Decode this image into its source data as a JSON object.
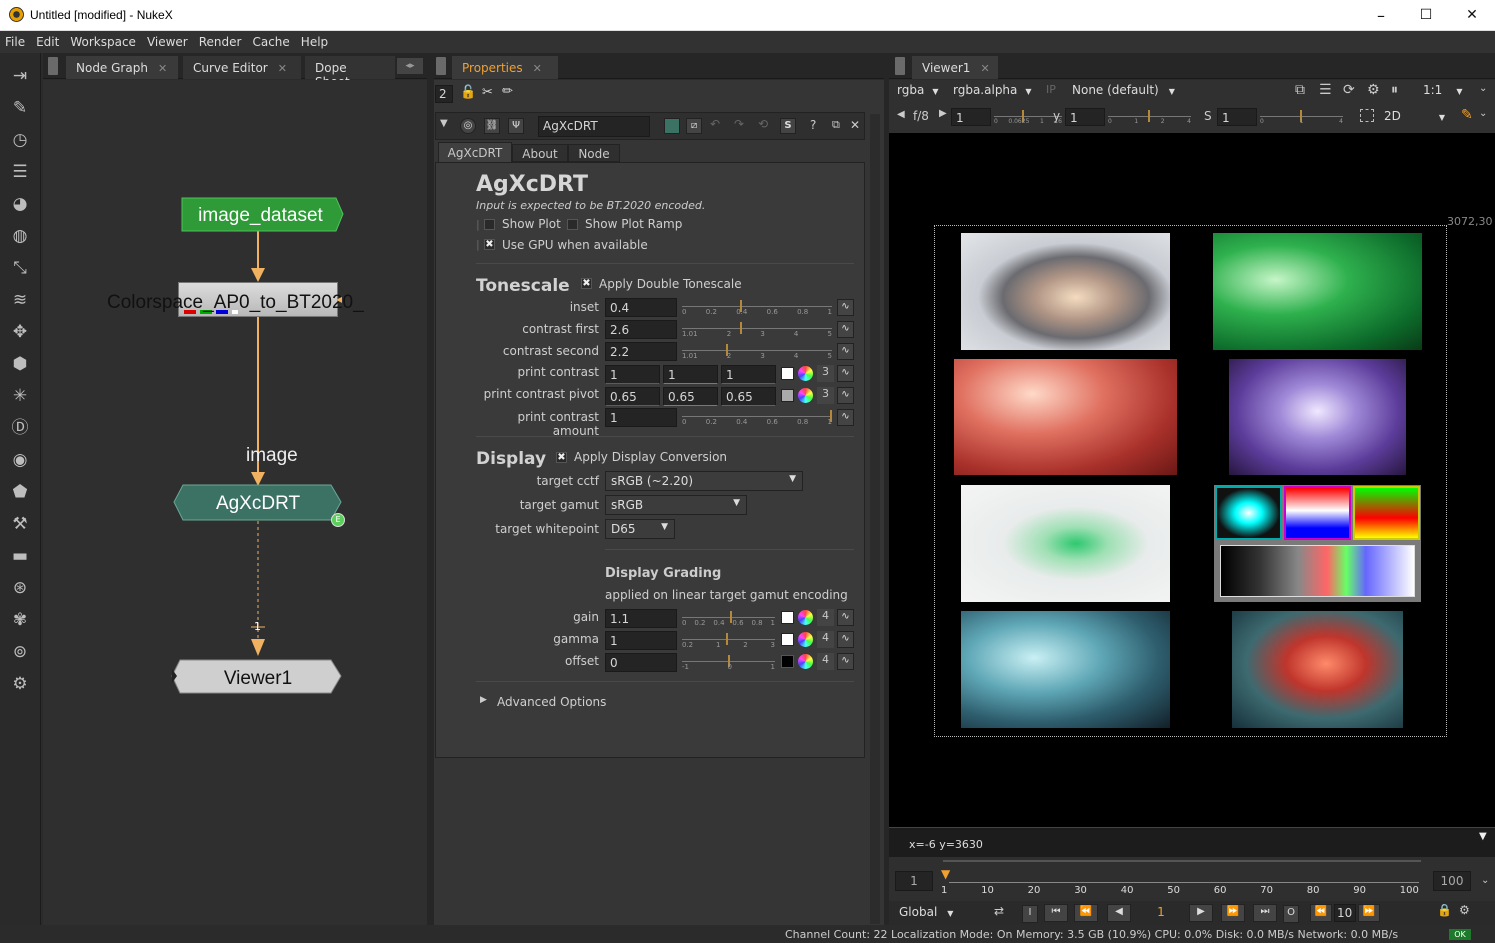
{
  "window": {
    "title": "Untitled [modified] - NukeX",
    "minimize": "–",
    "maximize": "☐",
    "close": "✕"
  },
  "menu": [
    "File",
    "Edit",
    "Workspace",
    "Viewer",
    "Render",
    "Cache",
    "Help"
  ],
  "left_tabs": {
    "node_graph": "Node Graph",
    "curve_editor": "Curve Editor",
    "dope_sheet": "Dope Sheet"
  },
  "nodes": {
    "read": "image_dataset",
    "colorspace": "Colorspace_AP0_to_BT2020_",
    "input_label": "image",
    "agx": "AgXcDRT",
    "viewer": "Viewer1",
    "viewer_pipe": "1"
  },
  "properties": {
    "tab": "Properties",
    "max_panels": "2",
    "node_name": "AgXcDRT",
    "subtabs": [
      "AgXcDRT",
      "About",
      "Node"
    ],
    "title": "AgXcDRT",
    "subtitle": "Input is expected to be BT.2020 encoded.",
    "show_plot": "Show Plot",
    "show_plot_ramp": "Show Plot Ramp",
    "use_gpu": "Use GPU when available",
    "tonescale": {
      "header": "Tonescale",
      "apply_double": "Apply Double Tonescale",
      "inset_label": "inset",
      "inset": "0.4",
      "contrast_first_label": "contrast first",
      "contrast_first": "2.6",
      "contrast_second_label": "contrast second",
      "contrast_second": "2.2",
      "print_contrast_label": "print contrast",
      "print_contrast": [
        "1",
        "1",
        "1"
      ],
      "print_contrast_n": "3",
      "pivot_label": "print contrast pivot",
      "pivot": [
        "0.65",
        "0.65",
        "0.65"
      ],
      "pivot_n": "3",
      "amount_label": "print contrast amount",
      "amount": "1",
      "ticks_a": [
        "0",
        "0.2",
        "0.4",
        "0.6",
        "0.8",
        "1"
      ],
      "ticks_b": [
        "1.01",
        "2",
        "3",
        "4",
        "5"
      ]
    },
    "display": {
      "header": "Display",
      "apply": "Apply Display Conversion",
      "cctf_label": "target cctf",
      "cctf": "sRGB (~2.20)",
      "gamut_label": "target gamut",
      "gamut": "sRGB",
      "wp_label": "target whitepoint",
      "wp": "D65",
      "grading_header": "Display Grading",
      "grading_sub": "applied on linear target gamut encoding",
      "gain_label": "gain",
      "gain": "1.1",
      "gamma_label": "gamma",
      "gamma": "1",
      "offset_label": "offset",
      "offset": "0",
      "n4": "4",
      "ticks_gain": [
        "0",
        "0.2",
        "0.4",
        "0.6",
        "0.8",
        "1"
      ],
      "ticks_gamma": [
        "0.2",
        "1",
        "2",
        "3"
      ],
      "ticks_offset": [
        "-1",
        "0",
        "1"
      ]
    },
    "advanced": "Advanced Options"
  },
  "viewer": {
    "tab": "Viewer1",
    "channels": "rgba",
    "alpha": "rgba.alpha",
    "ip": "IP",
    "lut": "None (default)",
    "zoom": "1:1",
    "fstop": "f/8",
    "gain": "1",
    "gain_ticks": [
      "0",
      "0.0625",
      "1",
      "16"
    ],
    "gamma_label": "y",
    "gamma": "1",
    "gamma_ticks": [
      "0",
      "1",
      "2",
      "4"
    ],
    "scale_label": "S",
    "scale": "1",
    "scale_ticks": [
      "0",
      "1",
      "4"
    ],
    "mode": "2D",
    "format": "3072,30",
    "coords": "x=-6 y=3630",
    "timeline": {
      "start": "1",
      "end": "100",
      "current": "1",
      "ticks": [
        "1",
        "10",
        "20",
        "30",
        "40",
        "50",
        "60",
        "70",
        "80",
        "90",
        "100"
      ],
      "global": "Global",
      "step": "10",
      "in": "I",
      "out": "O"
    }
  },
  "status": "Channel Count: 22  Localization Mode: On  Memory: 3.5 GB (10.9%)  CPU: 0.0%  Disk: 0.0 MB/s  Network: 0.0 MB/s",
  "status_ok": "OK"
}
